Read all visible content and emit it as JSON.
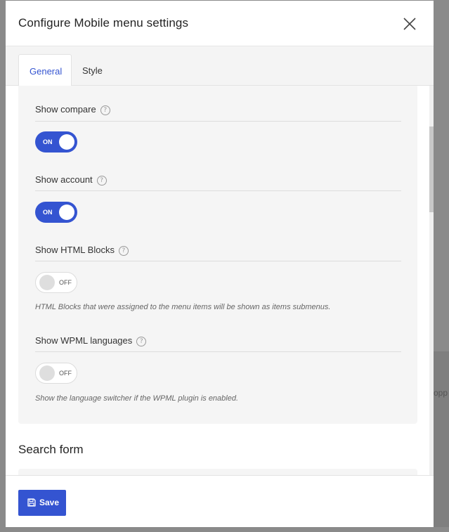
{
  "modal": {
    "title": "Configure Mobile menu settings"
  },
  "tabs": [
    {
      "label": "General",
      "active": true
    },
    {
      "label": "Style",
      "active": false
    }
  ],
  "fields": [
    {
      "label": "Show compare",
      "state": "ON",
      "enabled": true,
      "description": ""
    },
    {
      "label": "Show account",
      "state": "ON",
      "enabled": true,
      "description": ""
    },
    {
      "label": "Show HTML Blocks",
      "state": "OFF",
      "enabled": false,
      "description": "HTML Blocks that were assigned to the menu items will be shown as items submenus."
    },
    {
      "label": "Show WPML languages",
      "state": "OFF",
      "enabled": false,
      "description": "Show the language switcher if the WPML plugin is enabled."
    }
  ],
  "sections": {
    "search_form_title": "Search form"
  },
  "footer": {
    "save_label": "Save"
  },
  "backdrop": {
    "partial_text": "opp"
  },
  "colors": {
    "accent": "#3454d1",
    "panel_bg": "#f5f5f5",
    "overlay": "#8a8a8a"
  },
  "icons": {
    "close": "close-icon",
    "help": "help-icon",
    "save": "floppy-disk-icon"
  }
}
